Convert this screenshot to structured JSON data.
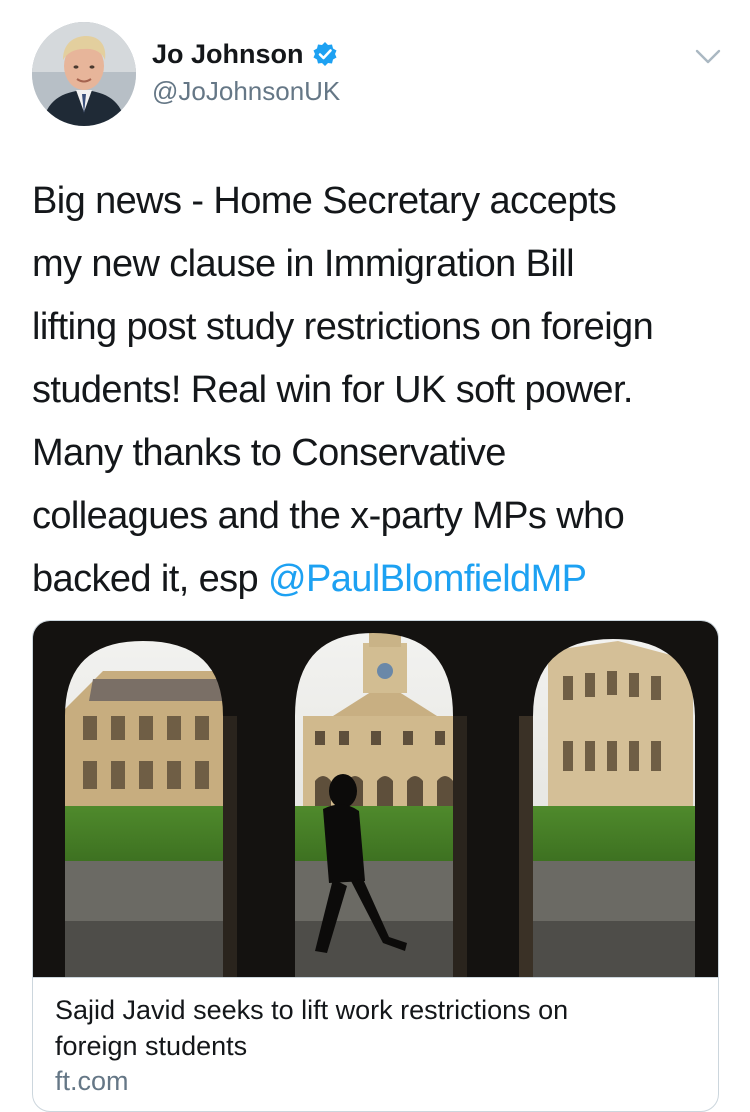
{
  "author": {
    "name": "Jo Johnson",
    "handle": "@JoJohnsonUK",
    "verified_icon": "verified-badge-icon",
    "menu_icon": "chevron-down-icon"
  },
  "tweet": {
    "lines": [
      "Big news - Home Secretary accepts",
      "my new clause in Immigration Bill",
      "lifting post study restrictions on foreign",
      "students! Real win for UK soft power.",
      "Many thanks to Conservative",
      "colleagues and the x-party MPs who"
    ],
    "last_line_prefix": "backed it, esp ",
    "mention": "@PaulBlomfieldMP"
  },
  "link_card": {
    "title_line1": "Sajid Javid seeks to lift work restrictions on",
    "title_line2": "foreign students",
    "domain": "ft.com"
  },
  "colors": {
    "link": "#1da1f2",
    "text": "#14171a",
    "secondary": "#657786",
    "border": "#ccd6dd"
  }
}
